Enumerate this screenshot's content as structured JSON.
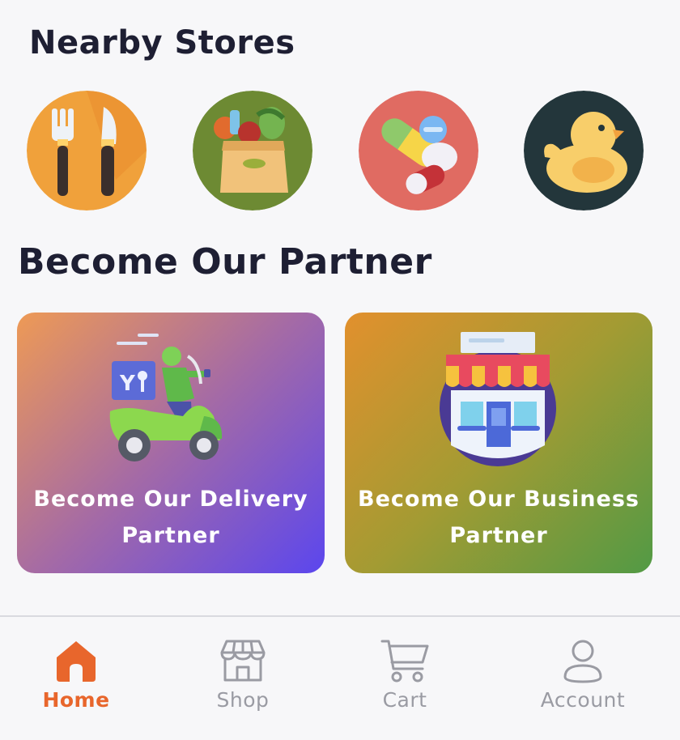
{
  "sections": {
    "nearby_title": "Nearby Stores",
    "partner_title": "Become Our Partner"
  },
  "stores": [
    {
      "icon": "restaurant-icon",
      "bg": "#f0a13b"
    },
    {
      "icon": "grocery-icon",
      "bg": "#6d8a33"
    },
    {
      "icon": "pharmacy-icon",
      "bg": "#e06b62"
    },
    {
      "icon": "duck-toy-icon",
      "bg": "#23363b"
    }
  ],
  "partners": {
    "delivery_label": "Become Our Delivery Partner",
    "business_label": "Become Our Business Partner"
  },
  "nav": {
    "home": "Home",
    "shop": "Shop",
    "cart": "Cart",
    "account": "Account",
    "active": "home",
    "active_color": "#e8662c",
    "inactive_color": "#9a9ba3"
  }
}
